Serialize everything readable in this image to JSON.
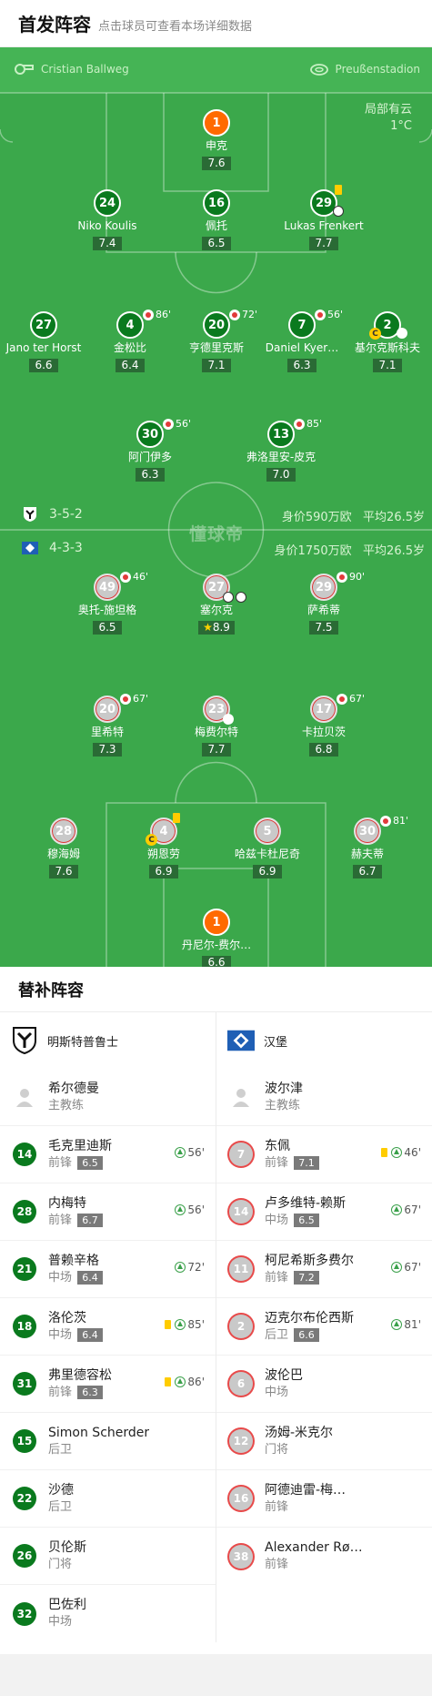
{
  "header": {
    "title": "首发阵容",
    "subtitle": "点击球员可查看本场详细数据"
  },
  "pitch": {
    "referee": "Cristian Ballweg",
    "venue": "Preußenstadion",
    "weather": "局部有云",
    "temperature": "1°C",
    "watermark": "懂球帝",
    "home_team": {
      "formation": "3-5-2",
      "value": "身价590万欧",
      "avg_age": "平均26.5岁"
    },
    "away_team": {
      "formation": "4-3-3",
      "value": "身价1750万欧",
      "avg_age": "平均26.5岁"
    }
  },
  "home_players": [
    {
      "num": "1",
      "name": "申克",
      "rating": "7.6",
      "gk": true
    },
    {
      "num": "24",
      "name": "Niko Koulis",
      "rating": "7.4"
    },
    {
      "num": "16",
      "name": "佩托",
      "rating": "6.5"
    },
    {
      "num": "29",
      "name": "Lukas Frenkert",
      "rating": "7.7"
    },
    {
      "num": "27",
      "name": "Jano ter Horst",
      "rating": "6.6"
    },
    {
      "num": "4",
      "name": "金松比",
      "rating": "6.4",
      "sub": "86'"
    },
    {
      "num": "20",
      "name": "亨德里克斯",
      "rating": "7.1",
      "sub": "72'"
    },
    {
      "num": "7",
      "name": "Daniel Kyer…",
      "rating": "6.3",
      "sub": "56'"
    },
    {
      "num": "2",
      "name": "基尔克斯科夫",
      "rating": "7.1"
    },
    {
      "num": "30",
      "name": "阿门伊多",
      "rating": "6.3",
      "sub": "56'"
    },
    {
      "num": "13",
      "name": "弗洛里安-皮克",
      "rating": "7.0",
      "sub": "85'"
    }
  ],
  "away_players": [
    {
      "num": "49",
      "name": "奥托-施坦格",
      "rating": "6.5",
      "sub": "46'"
    },
    {
      "num": "27",
      "name": "塞尔克",
      "rating": "8.9"
    },
    {
      "num": "29",
      "name": "萨希蒂",
      "rating": "7.5",
      "sub": "90'"
    },
    {
      "num": "20",
      "name": "里希特",
      "rating": "7.3",
      "sub": "67'"
    },
    {
      "num": "23",
      "name": "梅费尔特",
      "rating": "7.7"
    },
    {
      "num": "17",
      "name": "卡拉贝茨",
      "rating": "6.8",
      "sub": "67'"
    },
    {
      "num": "28",
      "name": "穆海姆",
      "rating": "7.6"
    },
    {
      "num": "4",
      "name": "朔恩劳",
      "rating": "6.9"
    },
    {
      "num": "5",
      "name": "哈兹卡杜尼奇",
      "rating": "6.9"
    },
    {
      "num": "30",
      "name": "赫夫蒂",
      "rating": "6.7",
      "sub": "81'"
    },
    {
      "num": "1",
      "name": "丹尼尔-费尔…",
      "rating": "6.6",
      "gk": true
    }
  ],
  "subs": {
    "title": "替补阵容",
    "home": {
      "team": "明斯特普鲁士",
      "coach": {
        "name": "希尔德曼",
        "role": "主教练"
      },
      "players": [
        {
          "num": "14",
          "name": "毛克里迪斯",
          "pos": "前锋",
          "rating": "6.5",
          "in": "56'"
        },
        {
          "num": "28",
          "name": "内梅特",
          "pos": "前锋",
          "rating": "6.7",
          "in": "56'"
        },
        {
          "num": "21",
          "name": "普赖辛格",
          "pos": "中场",
          "rating": "6.4",
          "in": "72'"
        },
        {
          "num": "18",
          "name": "洛伦茨",
          "pos": "中场",
          "rating": "6.4",
          "in": "85'",
          "card": true
        },
        {
          "num": "31",
          "name": "弗里德容松",
          "pos": "前锋",
          "rating": "6.3",
          "in": "86'",
          "card": true
        },
        {
          "num": "15",
          "name": "Simon Scherder",
          "pos": "后卫"
        },
        {
          "num": "22",
          "name": "沙德",
          "pos": "后卫"
        },
        {
          "num": "26",
          "name": "贝伦斯",
          "pos": "门将"
        },
        {
          "num": "32",
          "name": "巴佐利",
          "pos": "中场"
        }
      ]
    },
    "away": {
      "team": "汉堡",
      "coach": {
        "name": "波尔津",
        "role": "主教练"
      },
      "players": [
        {
          "num": "7",
          "name": "东佩",
          "pos": "前锋",
          "rating": "7.1",
          "in": "46'",
          "card": true
        },
        {
          "num": "14",
          "name": "卢多维特-赖斯",
          "pos": "中场",
          "rating": "6.5",
          "in": "67'"
        },
        {
          "num": "11",
          "name": "柯尼希斯多费尔",
          "pos": "前锋",
          "rating": "7.2",
          "in": "67'"
        },
        {
          "num": "2",
          "name": "迈克尔布伦西斯",
          "pos": "后卫",
          "rating": "6.6",
          "in": "81'"
        },
        {
          "num": "6",
          "name": "波伦巴",
          "pos": "中场"
        },
        {
          "num": "12",
          "name": "汤姆-米克尔",
          "pos": "门将"
        },
        {
          "num": "16",
          "name": "阿德迪雷-梅…",
          "pos": "前锋"
        },
        {
          "num": "38",
          "name": "Alexander Rø…",
          "pos": "前锋"
        }
      ]
    }
  }
}
